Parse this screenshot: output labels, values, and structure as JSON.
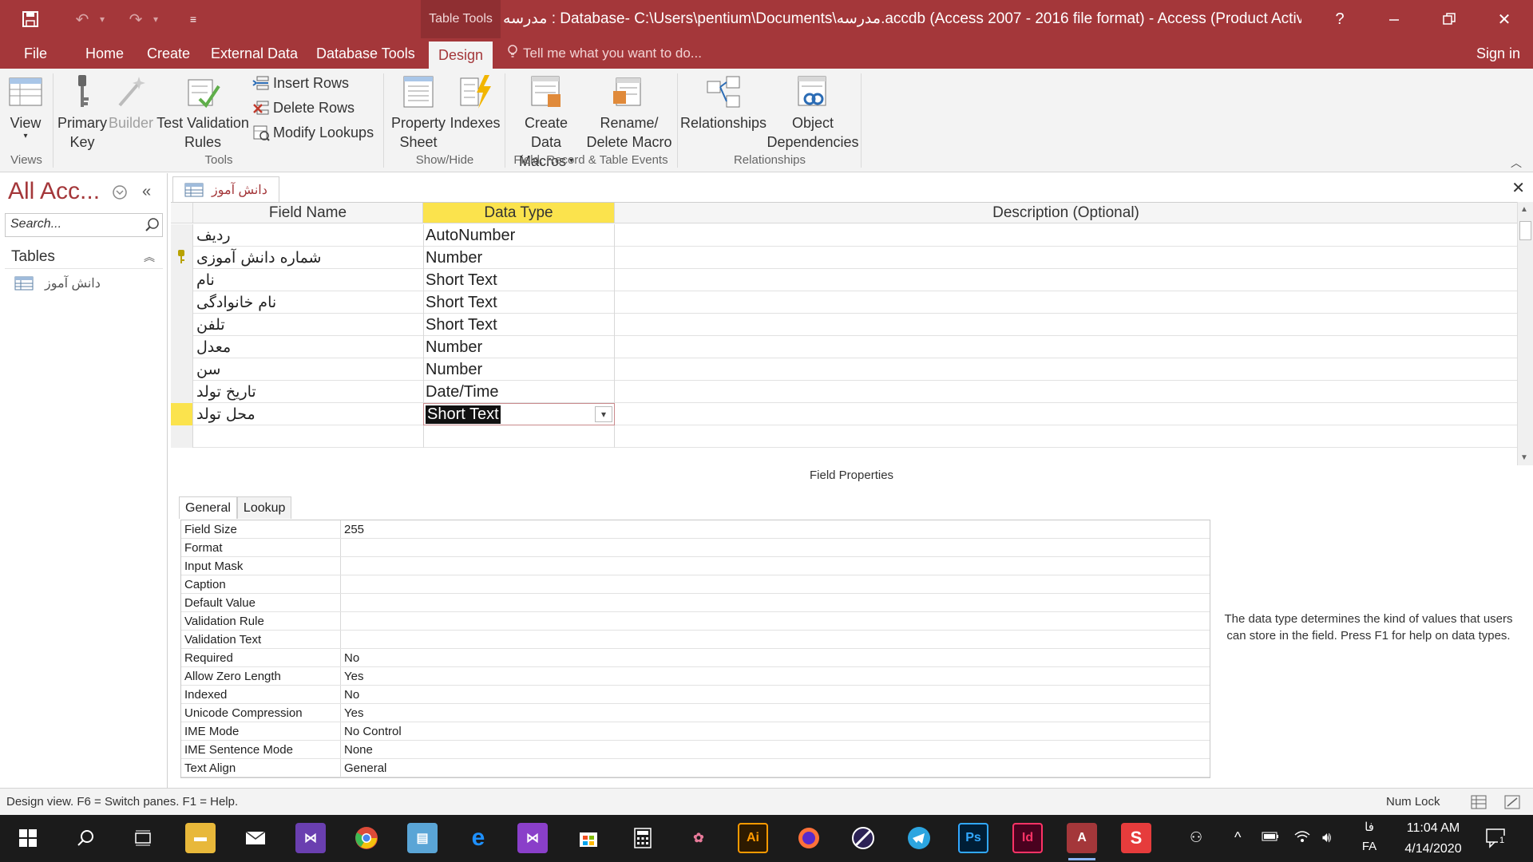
{
  "titlebar": {
    "contextual_tab": "Table Tools",
    "title": "مدرسه : Database- C:\\Users\\pentium\\Documents\\مدرسه.accdb (Access 2007 - 2016 file format) - Access (Product Activation...",
    "help": "?"
  },
  "tabs": [
    "File",
    "Home",
    "Create",
    "External Data",
    "Database Tools",
    "Design"
  ],
  "active_tab": "Design",
  "tell_me": "Tell me what you want to do...",
  "sign_in": "Sign in",
  "ribbon": {
    "view": {
      "label": "View"
    },
    "primary_key": {
      "line1": "Primary",
      "line2": "Key"
    },
    "builder": {
      "label": "Builder"
    },
    "test_validation": {
      "line1": "Test Validation",
      "line2": "Rules"
    },
    "insert_rows": "Insert Rows",
    "delete_rows": "Delete Rows",
    "modify_lookups": "Modify Lookups",
    "property_sheet": {
      "line1": "Property",
      "line2": "Sheet"
    },
    "indexes": {
      "label": "Indexes"
    },
    "create_data_macros": {
      "line1": "Create Data",
      "line2": "Macros"
    },
    "rename_delete_macro": {
      "line1": "Rename/",
      "line2": "Delete Macro"
    },
    "relationships": {
      "label": "Relationships"
    },
    "object_dependencies": {
      "line1": "Object",
      "line2": "Dependencies"
    },
    "groups": {
      "views": "Views",
      "tools": "Tools",
      "show_hide": "Show/Hide",
      "field_events": "Field, Record & Table Events",
      "relationships": "Relationships"
    }
  },
  "nav": {
    "title": "All Acc...",
    "search_placeholder": "Search...",
    "section": "Tables",
    "items": [
      "دانش آموز"
    ]
  },
  "document": {
    "tab_label": "دانش آموز",
    "columns": [
      "Field Name",
      "Data Type",
      "Description (Optional)"
    ],
    "rows": [
      {
        "field": "ردیف",
        "type": "AutoNumber"
      },
      {
        "field": "شماره دانش آموزی",
        "type": "Number"
      },
      {
        "field": "نام",
        "type": "Short Text"
      },
      {
        "field": "نام خانوادگی",
        "type": "Short Text"
      },
      {
        "field": "تلفن",
        "type": "Short Text"
      },
      {
        "field": "معدل",
        "type": "Number"
      },
      {
        "field": "سن",
        "type": "Number"
      },
      {
        "field": "تاریخ تولد",
        "type": "Date/Time"
      },
      {
        "field": "محل تولد",
        "type": "Short Text"
      }
    ],
    "primary_key_row": 1,
    "current_row": 8
  },
  "field_properties": {
    "label": "Field Properties",
    "tabs": [
      "General",
      "Lookup"
    ],
    "rows": [
      {
        "key": "Field Size",
        "value": "255"
      },
      {
        "key": "Format",
        "value": ""
      },
      {
        "key": "Input Mask",
        "value": ""
      },
      {
        "key": "Caption",
        "value": ""
      },
      {
        "key": "Default Value",
        "value": ""
      },
      {
        "key": "Validation Rule",
        "value": ""
      },
      {
        "key": "Validation Text",
        "value": ""
      },
      {
        "key": "Required",
        "value": "No"
      },
      {
        "key": "Allow Zero Length",
        "value": "Yes"
      },
      {
        "key": "Indexed",
        "value": "No"
      },
      {
        "key": "Unicode Compression",
        "value": "Yes"
      },
      {
        "key": "IME Mode",
        "value": "No Control"
      },
      {
        "key": "IME Sentence Mode",
        "value": "None"
      },
      {
        "key": "Text Align",
        "value": "General"
      }
    ],
    "help": "The data type determines the kind of values that users can store in the field. Press F1 for help on data types."
  },
  "status": {
    "text": "Design view.  F6 = Switch panes.  F1 = Help.",
    "num_lock": "Num Lock"
  },
  "taskbar": {
    "lang_top": "فا",
    "lang_bottom": "FA",
    "time": "11:04 AM",
    "date": "4/14/2020",
    "notification_count": "1"
  },
  "colors": {
    "accent": "#a4373a",
    "selected_header": "#fbe34d"
  }
}
